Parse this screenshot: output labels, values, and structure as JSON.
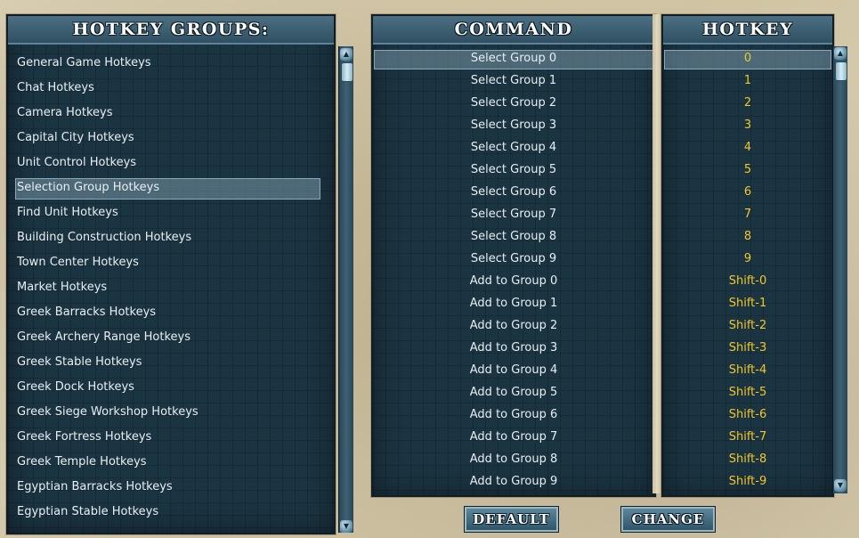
{
  "groups_panel": {
    "title": "HOTKEY GROUPS:",
    "items": [
      "General Game Hotkeys",
      "Chat Hotkeys",
      "Camera Hotkeys",
      "Capital City Hotkeys",
      "Unit Control Hotkeys",
      "Selection Group Hotkeys",
      "Find Unit Hotkeys",
      "Building Construction Hotkeys",
      "Town Center Hotkeys",
      "Market Hotkeys",
      "Greek Barracks Hotkeys",
      "Greek Archery Range Hotkeys",
      "Greek Stable Hotkeys",
      "Greek Dock Hotkeys",
      "Greek Siege Workshop Hotkeys",
      "Greek Fortress Hotkeys",
      "Greek Temple Hotkeys",
      "Egyptian Barracks Hotkeys",
      "Egyptian Stable Hotkeys"
    ],
    "selected_index": 5
  },
  "command_panel": {
    "title": "COMMAND",
    "rows": [
      {
        "command": "Select Group 0",
        "hotkey": "0"
      },
      {
        "command": "Select Group 1",
        "hotkey": "1"
      },
      {
        "command": "Select Group 2",
        "hotkey": "2"
      },
      {
        "command": "Select Group 3",
        "hotkey": "3"
      },
      {
        "command": "Select Group 4",
        "hotkey": "4"
      },
      {
        "command": "Select Group 5",
        "hotkey": "5"
      },
      {
        "command": "Select Group 6",
        "hotkey": "6"
      },
      {
        "command": "Select Group 7",
        "hotkey": "7"
      },
      {
        "command": "Select Group 8",
        "hotkey": "8"
      },
      {
        "command": "Select Group 9",
        "hotkey": "9"
      },
      {
        "command": "Add to Group 0",
        "hotkey": "Shift-0"
      },
      {
        "command": "Add to Group 1",
        "hotkey": "Shift-1"
      },
      {
        "command": "Add to Group 2",
        "hotkey": "Shift-2"
      },
      {
        "command": "Add to Group 3",
        "hotkey": "Shift-3"
      },
      {
        "command": "Add to Group 4",
        "hotkey": "Shift-4"
      },
      {
        "command": "Add to Group 5",
        "hotkey": "Shift-5"
      },
      {
        "command": "Add to Group 6",
        "hotkey": "Shift-6"
      },
      {
        "command": "Add to Group 7",
        "hotkey": "Shift-7"
      },
      {
        "command": "Add to Group 8",
        "hotkey": "Shift-8"
      },
      {
        "command": "Add to Group 9",
        "hotkey": "Shift-9"
      }
    ],
    "selected_index": 0
  },
  "hotkey_panel": {
    "title": "HOTKEY"
  },
  "buttons": {
    "default_label": "DEFAULT",
    "change_label": "CHANGE"
  },
  "colors": {
    "panel_bg": "#1b3442",
    "header_bg": "#3d6174",
    "hotkey_text": "#f2c72c",
    "list_text": "#e8eef2",
    "frame": "#d9cfb4"
  },
  "icons": {
    "scroll_up": "scroll-up-arrow-icon",
    "scroll_down": "scroll-down-arrow-icon",
    "scroll_thumb": "scroll-thumb"
  }
}
